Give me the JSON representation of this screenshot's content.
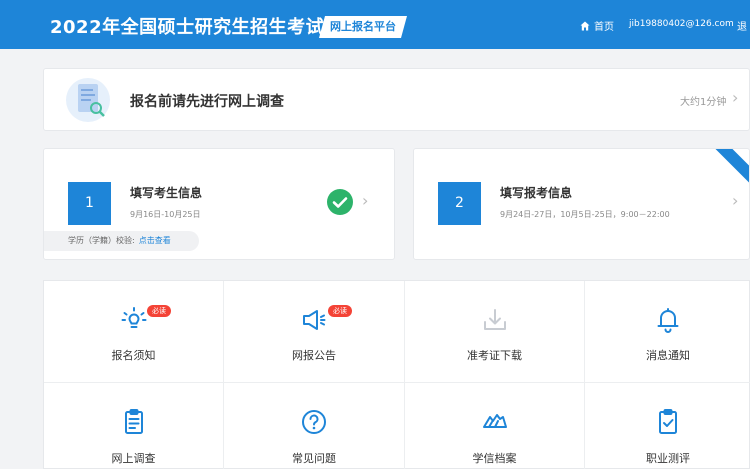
{
  "header": {
    "title": "2022年全国硕士研究生招生考试",
    "platform": "网上报名平台",
    "home_label": "首页",
    "email": "jib19880402@126.com",
    "logout_label": "退"
  },
  "survey": {
    "title": "报名前请先进行网上调查",
    "time_estimate": "大约1分钟"
  },
  "steps": [
    {
      "number": "1",
      "title": "填写考生信息",
      "dates": "9月16日-10月25日",
      "status": "completed",
      "verify_label": "学历（学籍）校验:",
      "verify_link": "点击查看"
    },
    {
      "number": "2",
      "title": "填写报考信息",
      "dates": "9月24日-27日，10月5日-25日，9:00－22:00"
    }
  ],
  "tiles": [
    {
      "label": "报名须知",
      "icon": "lightbulb-icon",
      "badge": "必读"
    },
    {
      "label": "网报公告",
      "icon": "megaphone-icon",
      "badge": "必读"
    },
    {
      "label": "准考证下载",
      "icon": "download-icon",
      "disabled": true
    },
    {
      "label": "消息通知",
      "icon": "bell-icon"
    },
    {
      "label": "网上调查",
      "icon": "clipboard-icon"
    },
    {
      "label": "常见问题",
      "icon": "question-icon"
    },
    {
      "label": "学信档案",
      "icon": "wings-icon"
    },
    {
      "label": "职业测评",
      "icon": "clipboard-check-icon"
    }
  ],
  "colors": {
    "primary": "#1e85d8",
    "success": "#2db36a",
    "badge": "#f44336",
    "background": "#f2f3f5"
  }
}
